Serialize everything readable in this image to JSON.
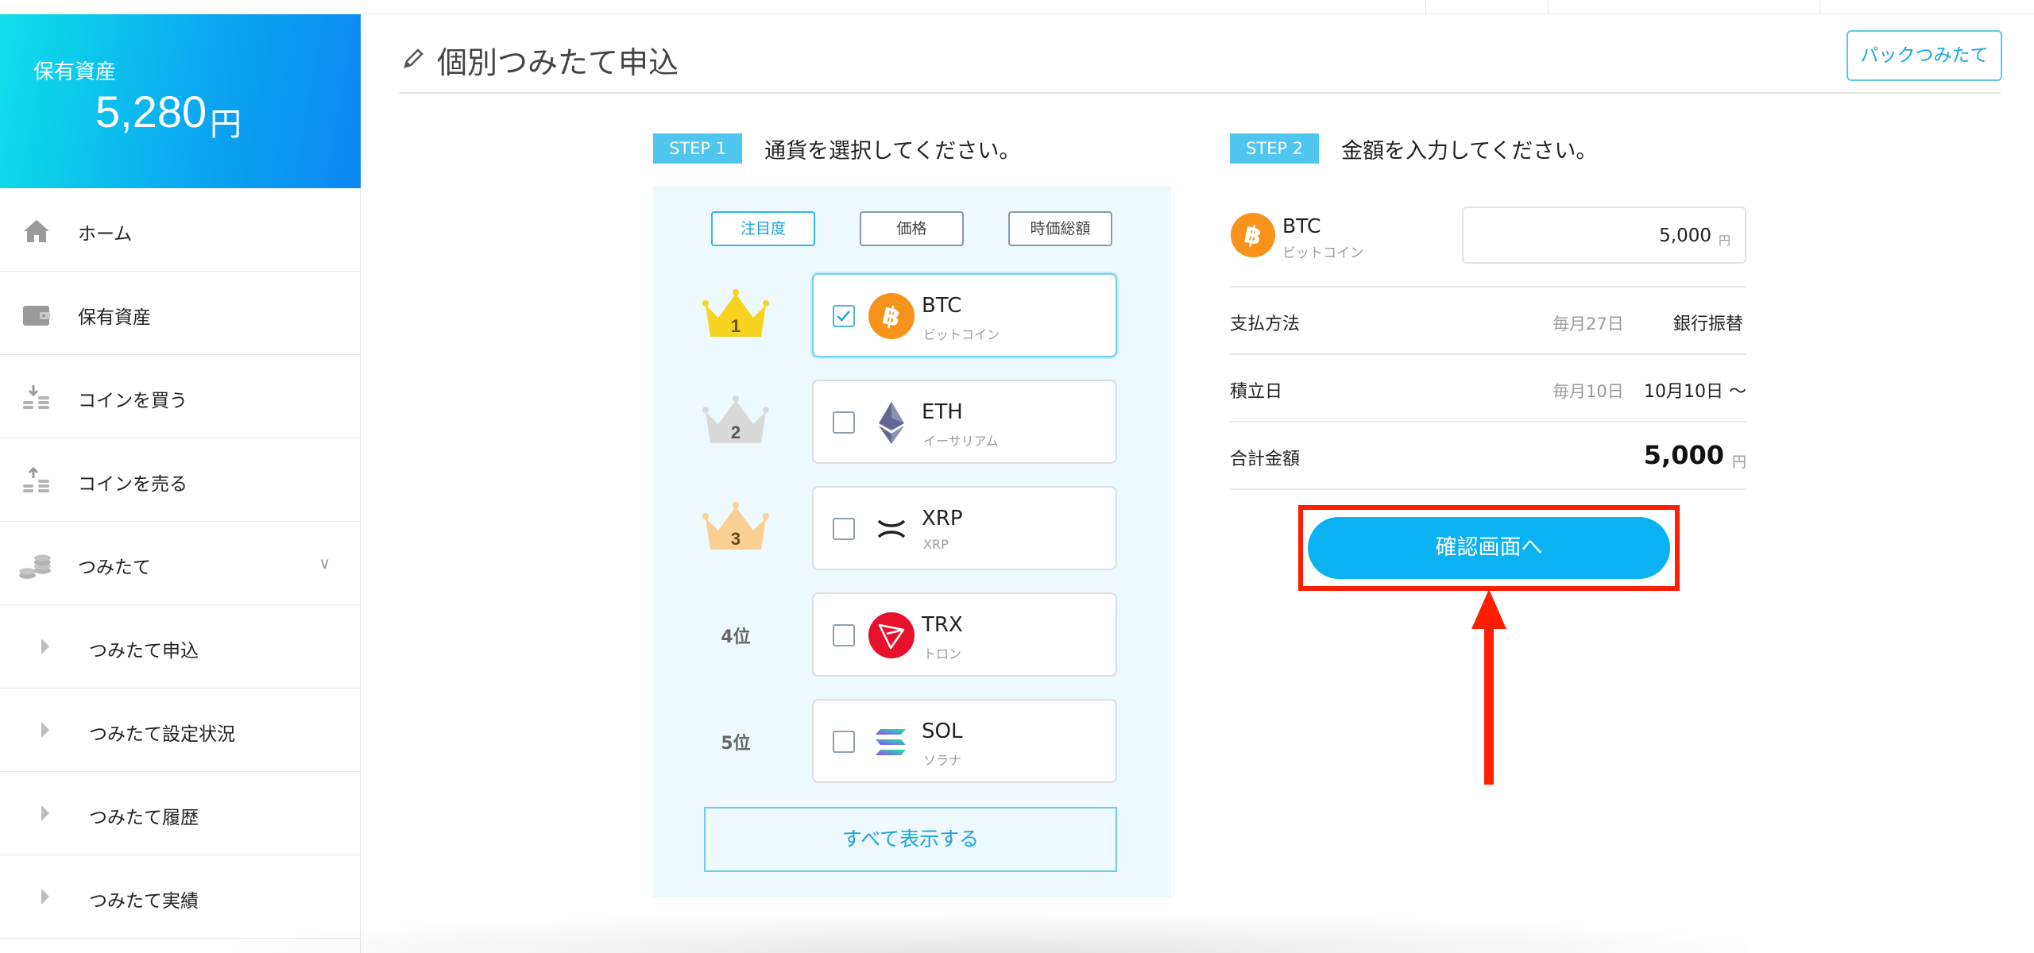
{
  "sidebar": {
    "balance_label": "保有資産",
    "balance_amount": "5,280",
    "balance_unit": "円",
    "items": [
      {
        "label": "ホーム",
        "icon": "home-icon"
      },
      {
        "label": "保有資産",
        "icon": "wallet-icon"
      },
      {
        "label": "コインを買う",
        "icon": "buy-coins-icon"
      },
      {
        "label": "コインを売る",
        "icon": "sell-coins-icon"
      },
      {
        "label": "つみたて",
        "icon": "savings-icon",
        "expanded": true
      },
      {
        "label": "つみたて申込"
      },
      {
        "label": "つみたて設定状況"
      },
      {
        "label": "つみたて履歴"
      },
      {
        "label": "つみたて実績"
      }
    ]
  },
  "header": {
    "title": "個別つみたて申込",
    "pack_button": "パックつみたて"
  },
  "step1": {
    "tag": "STEP 1",
    "text": "通貨を選択してください。",
    "sort_options": [
      "注目度",
      "価格",
      "時価総額"
    ],
    "active_sort": "注目度",
    "coins": [
      {
        "rank": "1",
        "symbol": "BTC",
        "name": "ビットコイン",
        "checked": true,
        "crown": "gold"
      },
      {
        "rank": "2",
        "symbol": "ETH",
        "name": "イーサリアム",
        "checked": false,
        "crown": "silver"
      },
      {
        "rank": "3",
        "symbol": "XRP",
        "name": "XRP",
        "checked": false,
        "crown": "bronze"
      },
      {
        "rank": "4位",
        "symbol": "TRX",
        "name": "トロン",
        "checked": false
      },
      {
        "rank": "5位",
        "symbol": "SOL",
        "name": "ソラナ",
        "checked": false
      }
    ],
    "show_all": "すべて表示する"
  },
  "step2": {
    "tag": "STEP 2",
    "text": "金額を入力してください。",
    "coin_symbol": "BTC",
    "coin_name": "ビットコイン",
    "amount_value": "5,000",
    "amount_unit": "円",
    "payment_label": "支払方法",
    "payment_note": "毎月27日",
    "payment_value": "銀行振替",
    "date_label": "積立日",
    "date_note": "毎月10日",
    "date_value": "10月10日 〜",
    "total_label": "合計金額",
    "total_value": "5,000",
    "total_unit": "円",
    "confirm_button": "確認画面へ"
  },
  "colors": {
    "accent": "#0ab2f2",
    "highlight": "#ff1e00",
    "panel_bg": "#eef9fd"
  }
}
